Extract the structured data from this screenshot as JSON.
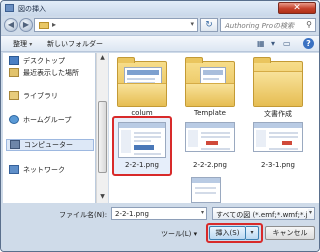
{
  "window": {
    "title": "図の挿入",
    "close_glyph": "✕"
  },
  "address": {
    "path_chevron": "▸",
    "dropdown": "▾"
  },
  "search": {
    "placeholder": "Authoring Proの検索",
    "icon": "search-icon"
  },
  "toolbar": {
    "organize": "整理",
    "new_folder": "新しいフォルダー",
    "help": "?"
  },
  "sidebar": {
    "items": [
      {
        "label": "デスクトップ",
        "icon": "desktop-icon"
      },
      {
        "label": "最近表示した場所",
        "icon": "recent-places-icon"
      },
      {
        "label": "ライブラリ",
        "icon": "library-icon"
      },
      {
        "label": "ホームグループ",
        "icon": "homegroup-icon"
      },
      {
        "label": "コンピューター",
        "icon": "computer-icon",
        "selected": true
      },
      {
        "label": "ネットワーク",
        "icon": "network-icon"
      }
    ]
  },
  "files": [
    {
      "name": "colum",
      "kind": "folder"
    },
    {
      "name": "Template",
      "kind": "folder"
    },
    {
      "name": "文書作成",
      "kind": "folder"
    },
    {
      "name": "2-2-1.png",
      "kind": "image",
      "selected": true
    },
    {
      "name": "2-2-2.png",
      "kind": "image"
    },
    {
      "name": "2-3-1.png",
      "kind": "image"
    }
  ],
  "bottom": {
    "filename_label": "ファイル名(N):",
    "filename_value": "2-2-1.png",
    "filetype_value": "すべての図 (*.emf;*.wmf;*.j",
    "tools_label": "ツール(L)",
    "insert_label": "挿入(S)",
    "cancel_label": "キャンセル"
  },
  "colors": {
    "selection_highlight": "#d82a2a",
    "accent": "#3c7fb1"
  }
}
